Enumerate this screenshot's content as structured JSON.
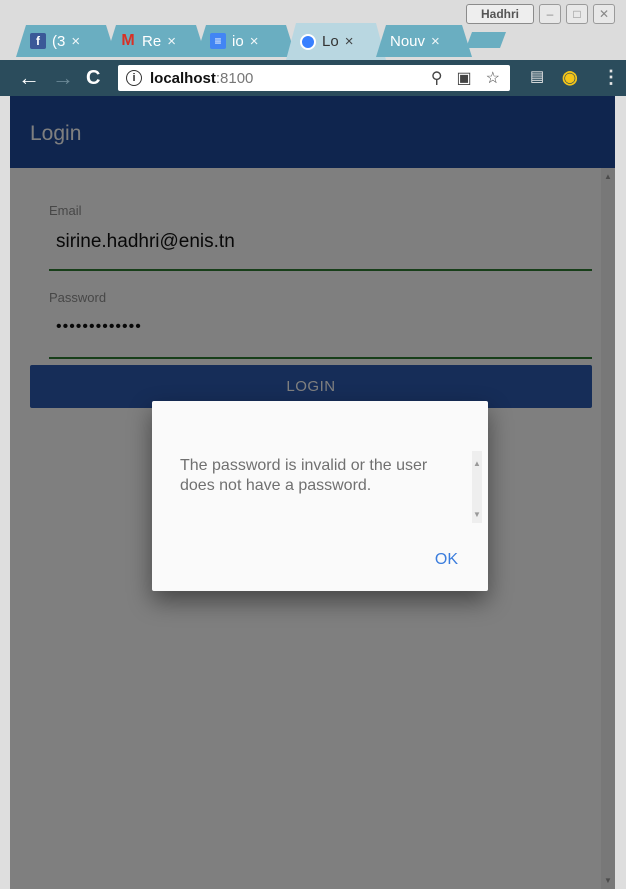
{
  "browser": {
    "tabs": [
      {
        "title": "(3",
        "favicon": "facebook-icon"
      },
      {
        "title": "Re",
        "favicon": "gmail-icon"
      },
      {
        "title": "io",
        "favicon": "docs-icon"
      },
      {
        "title": "Lo",
        "favicon": "ionic-icon"
      },
      {
        "title": "Nouv",
        "favicon": ""
      }
    ],
    "tab_close_glyph": "×",
    "profile_name": "Hadhri",
    "address": {
      "host": "localhost",
      "port": ":8100"
    },
    "colors": {
      "tab": "#6aaec1",
      "toolbar": "#2b4c5c"
    }
  },
  "app": {
    "header_title": "Login",
    "email": {
      "label": "Email",
      "value": "sirine.hadhri@enis.tn"
    },
    "password": {
      "label": "Password",
      "value": "•••••••••••••"
    },
    "login_button": "LOGIN",
    "colors": {
      "header": "#1e4b9c",
      "button": "#2d5bb0",
      "underline": "#2e7d32"
    }
  },
  "dialog": {
    "message": "The password is invalid or the user does not have a password.",
    "ok_label": "OK"
  }
}
